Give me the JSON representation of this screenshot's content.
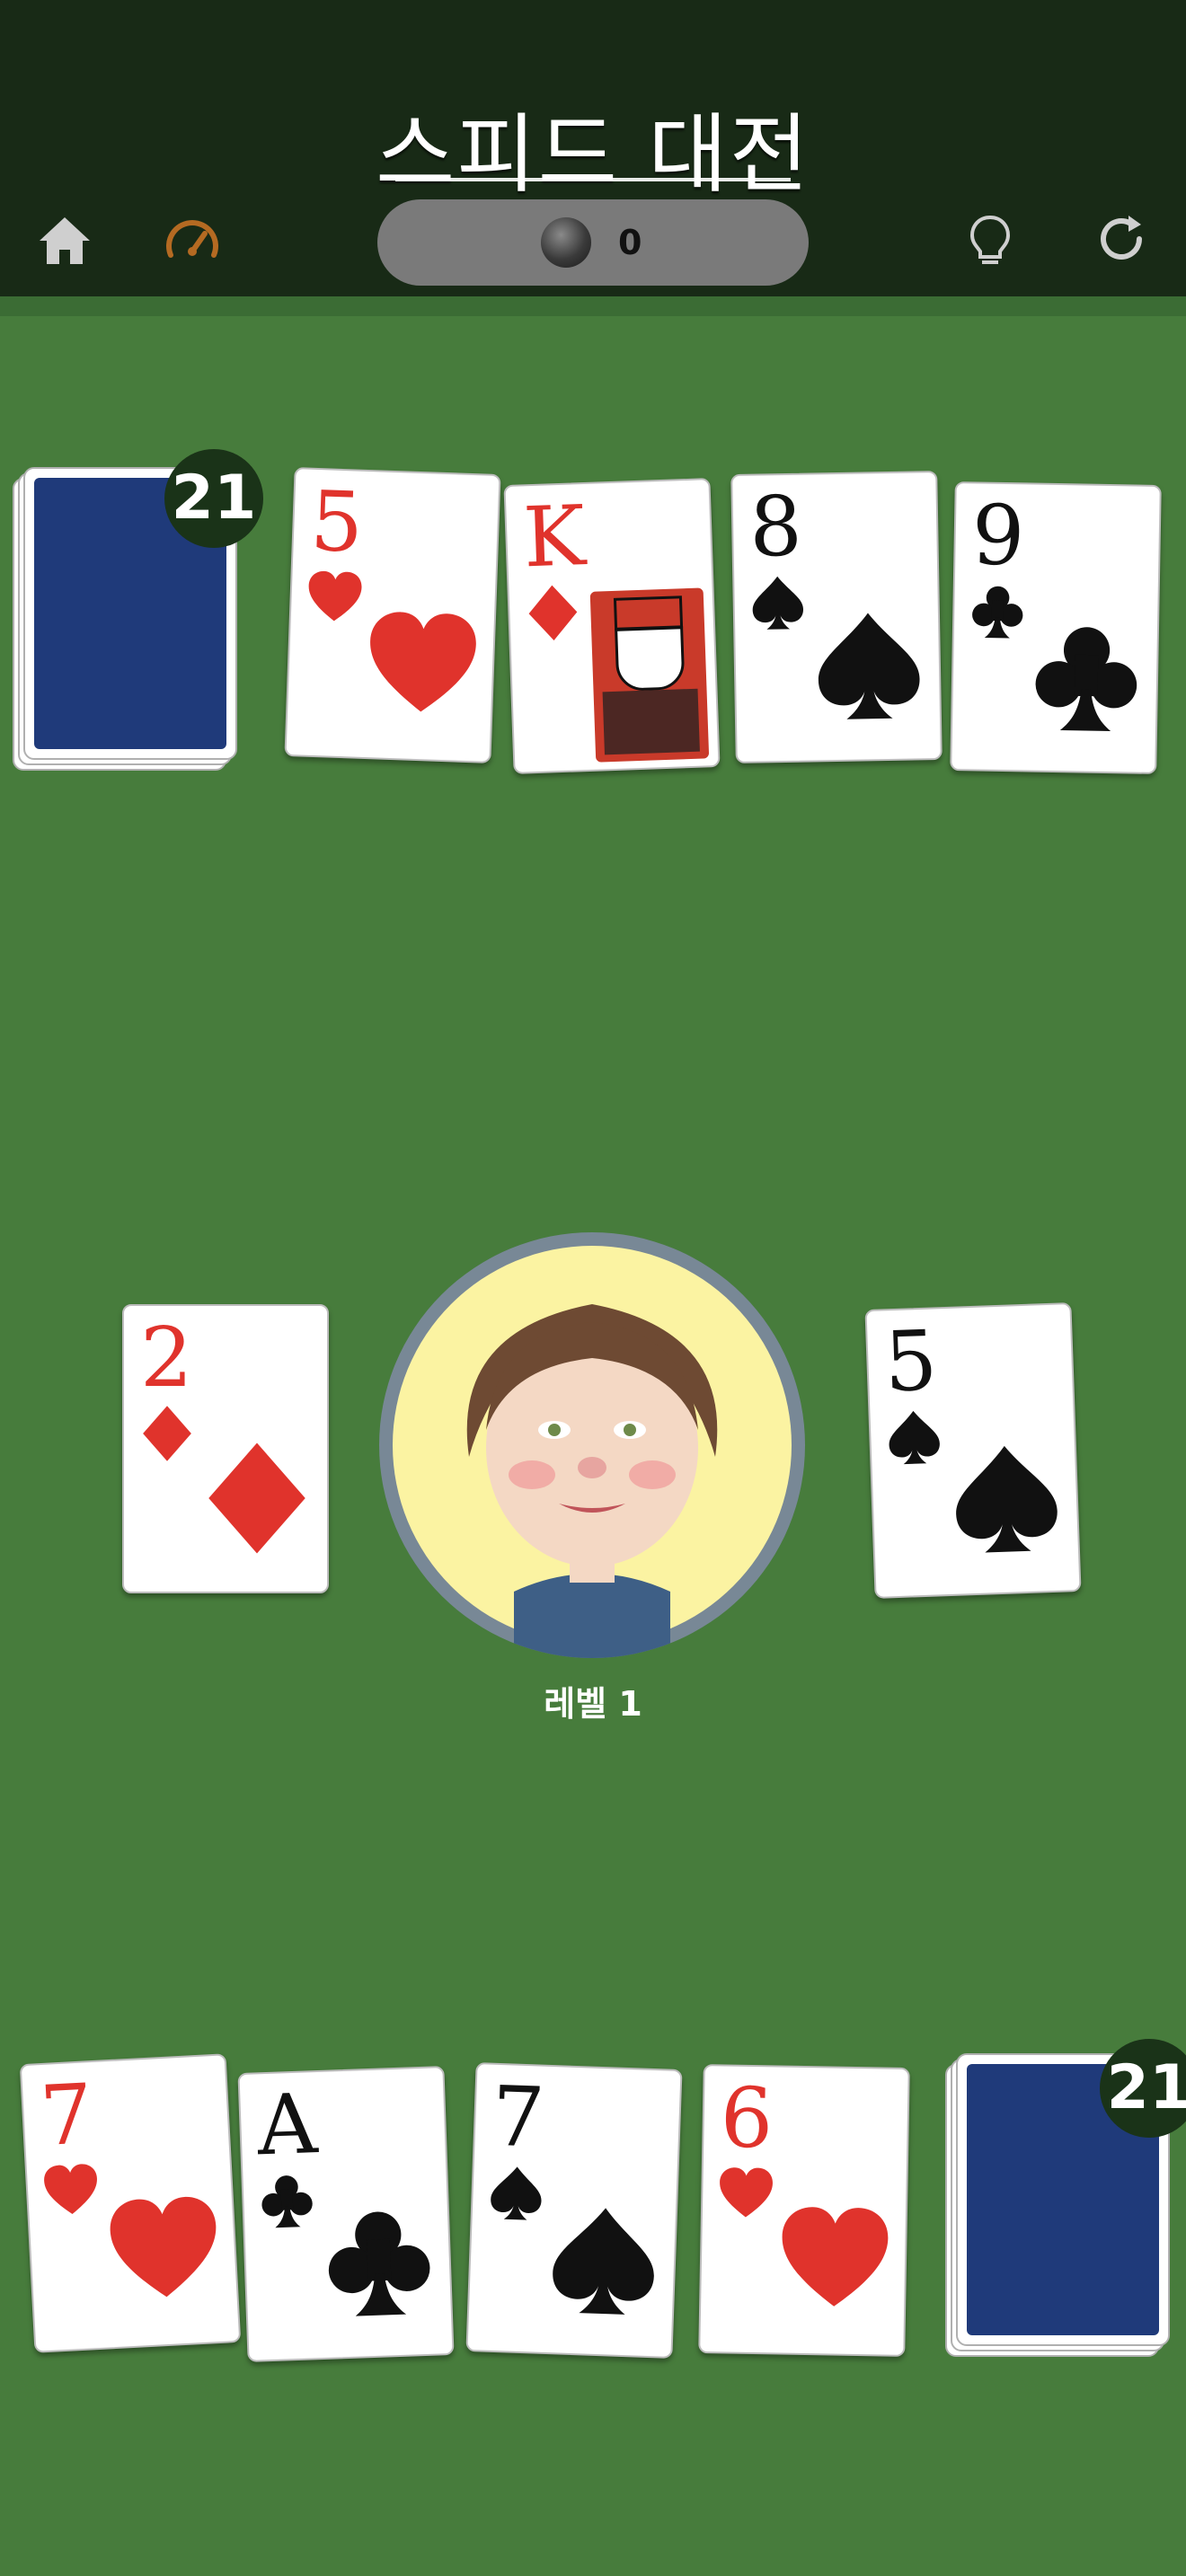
{
  "header": {
    "title": "스피드 대전",
    "score": "0",
    "icons": [
      "home-icon",
      "speedometer-icon",
      "lightbulb-icon",
      "refresh-icon"
    ]
  },
  "opponent": {
    "deck_count": "21",
    "hand": [
      {
        "rank": "5",
        "suit": "hearts"
      },
      {
        "rank": "K",
        "suit": "diamonds"
      },
      {
        "rank": "8",
        "suit": "spades"
      },
      {
        "rank": "9",
        "suit": "clubs"
      }
    ]
  },
  "center": {
    "left_pile": {
      "rank": "2",
      "suit": "diamonds"
    },
    "right_pile": {
      "rank": "5",
      "suit": "spades"
    },
    "level_label": "레벨 1"
  },
  "player": {
    "deck_count": "21",
    "hand": [
      {
        "rank": "7",
        "suit": "hearts"
      },
      {
        "rank": "A",
        "suit": "clubs"
      },
      {
        "rank": "7",
        "suit": "spades"
      },
      {
        "rank": "6",
        "suit": "hearts"
      }
    ]
  },
  "colors": {
    "table": "#477c3c",
    "header": "#182a16",
    "red_suit": "#e0332c",
    "black_suit": "#111111",
    "card_back": "#1f3a7a"
  }
}
